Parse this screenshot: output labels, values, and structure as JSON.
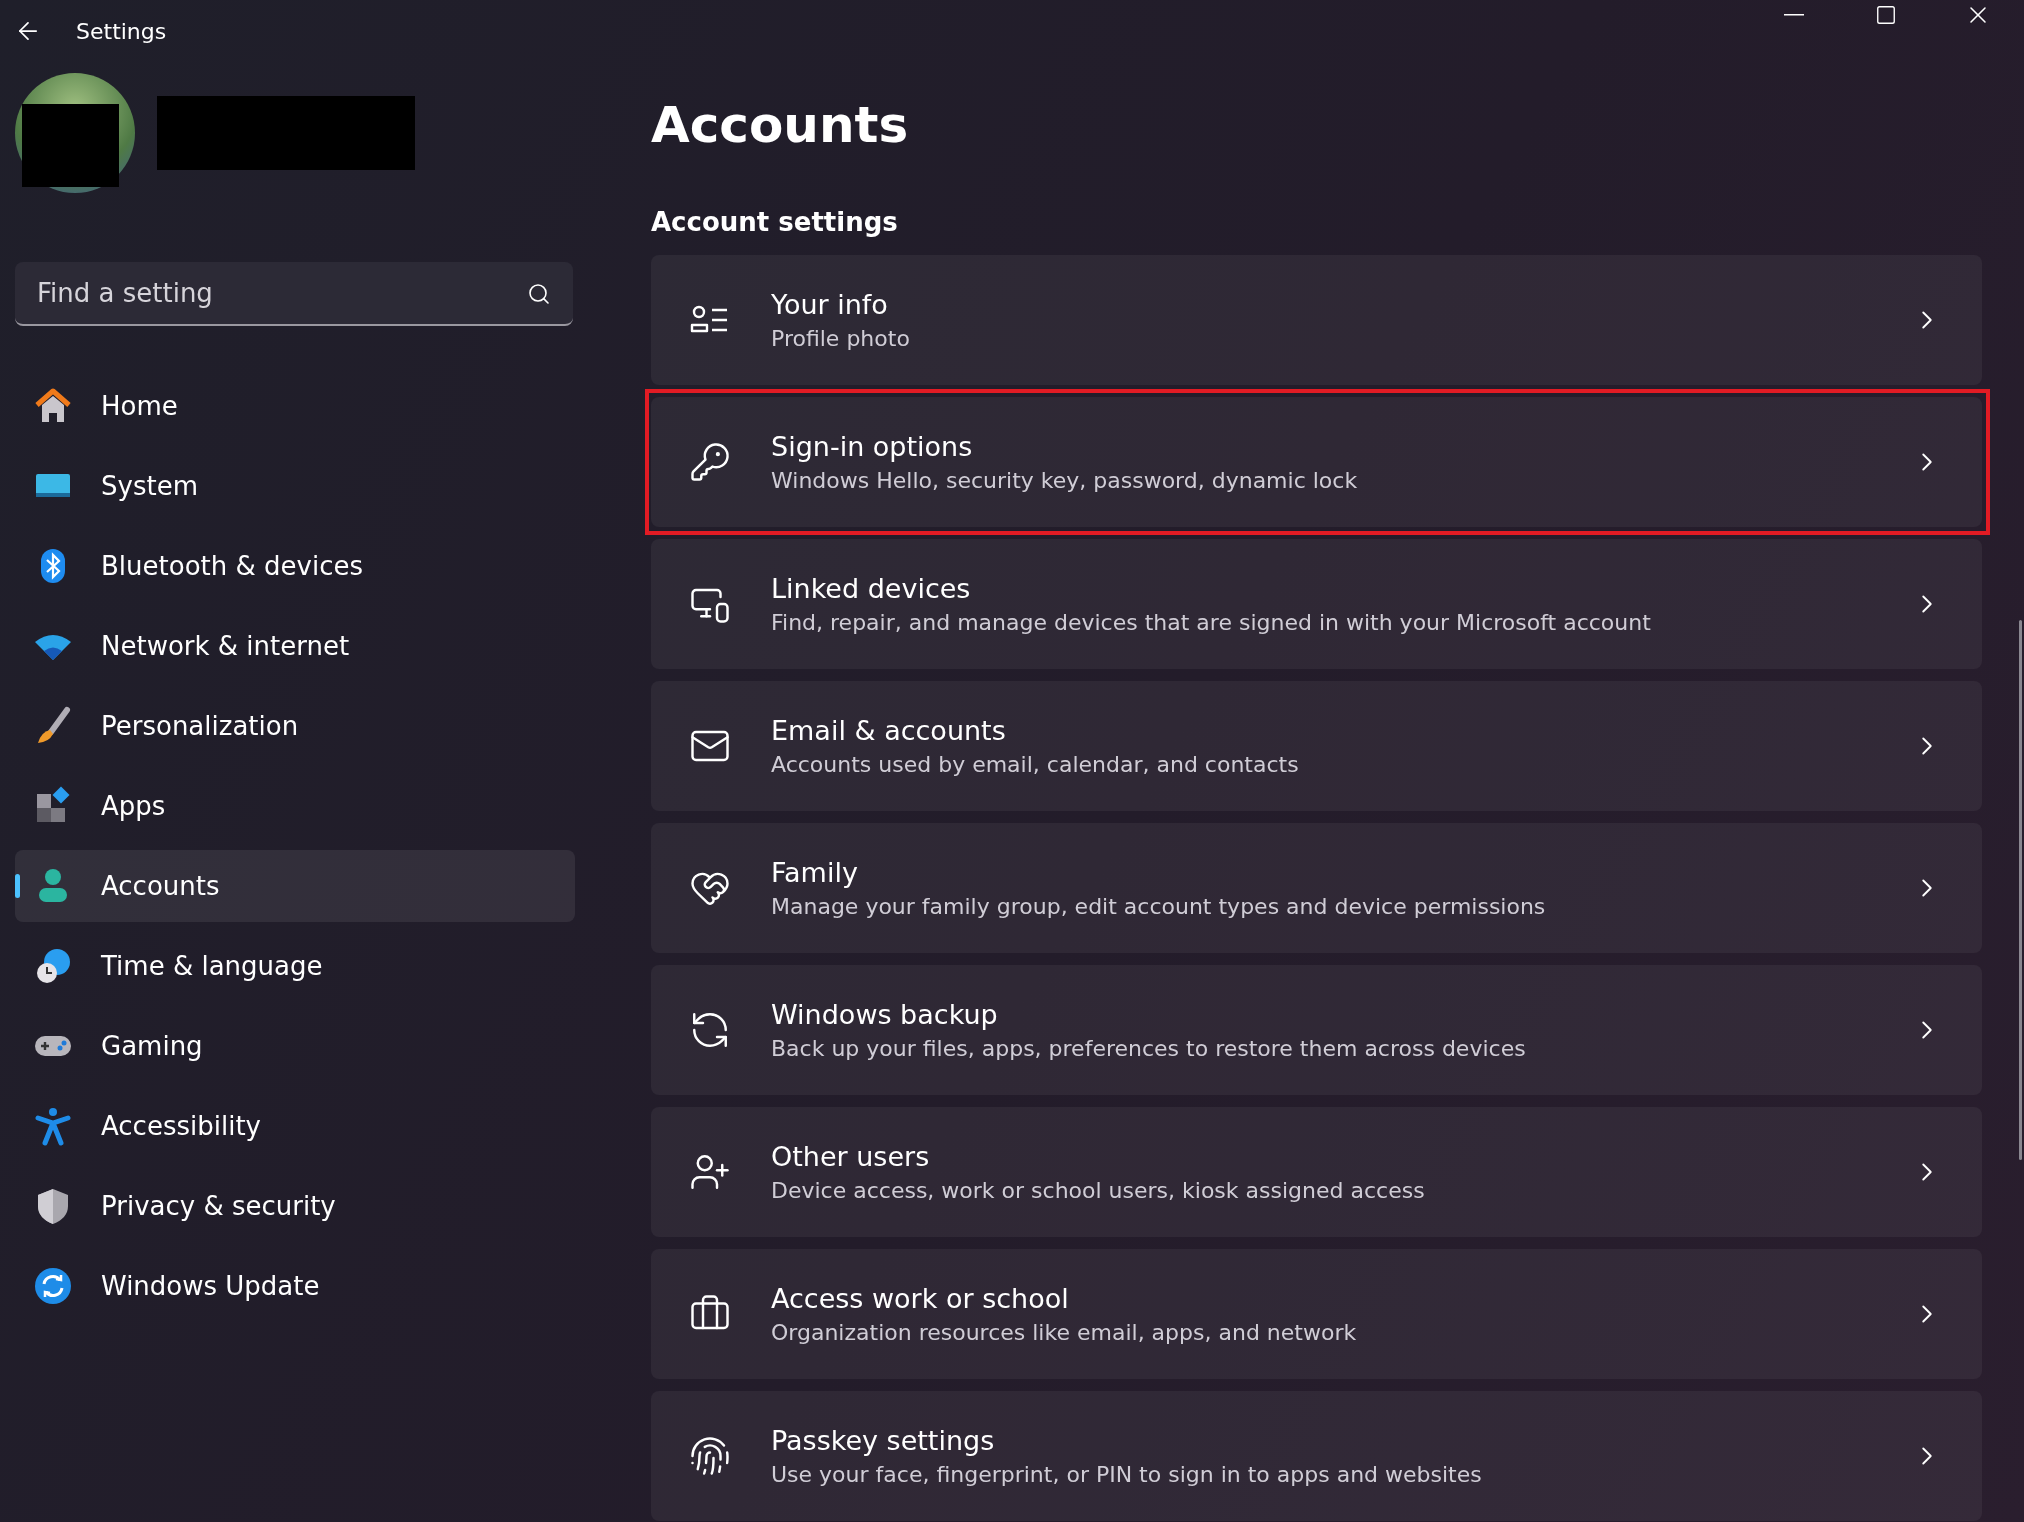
{
  "window": {
    "title": "Settings"
  },
  "search": {
    "placeholder": "Find a setting"
  },
  "sidebar": {
    "items": [
      {
        "label": "Home",
        "selected": false
      },
      {
        "label": "System",
        "selected": false
      },
      {
        "label": "Bluetooth & devices",
        "selected": false
      },
      {
        "label": "Network & internet",
        "selected": false
      },
      {
        "label": "Personalization",
        "selected": false
      },
      {
        "label": "Apps",
        "selected": false
      },
      {
        "label": "Accounts",
        "selected": true
      },
      {
        "label": "Time & language",
        "selected": false
      },
      {
        "label": "Gaming",
        "selected": false
      },
      {
        "label": "Accessibility",
        "selected": false
      },
      {
        "label": "Privacy & security",
        "selected": false
      },
      {
        "label": "Windows Update",
        "selected": false
      }
    ]
  },
  "page": {
    "title": "Accounts",
    "section": "Account settings"
  },
  "cards": [
    {
      "title": "Your info",
      "subtitle": "Profile photo",
      "highlighted": false
    },
    {
      "title": "Sign-in options",
      "subtitle": "Windows Hello, security key, password, dynamic lock",
      "highlighted": true
    },
    {
      "title": "Linked devices",
      "subtitle": "Find, repair, and manage devices that are signed in with your Microsoft account",
      "highlighted": false
    },
    {
      "title": "Email & accounts",
      "subtitle": "Accounts used by email, calendar, and contacts",
      "highlighted": false
    },
    {
      "title": "Family",
      "subtitle": "Manage your family group, edit account types and device permissions",
      "highlighted": false
    },
    {
      "title": "Windows backup",
      "subtitle": "Back up your files, apps, preferences to restore them across devices",
      "highlighted": false
    },
    {
      "title": "Other users",
      "subtitle": "Device access, work or school users, kiosk assigned access",
      "highlighted": false
    },
    {
      "title": "Access work or school",
      "subtitle": "Organization resources like email, apps, and network",
      "highlighted": false
    },
    {
      "title": "Passkey settings",
      "subtitle": "Use your face, fingerprint, or PIN to sign in to apps and websites",
      "highlighted": false
    }
  ]
}
